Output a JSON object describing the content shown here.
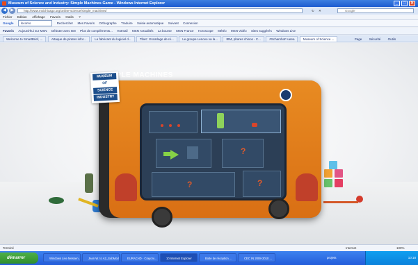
{
  "window": {
    "title": "Museum of Science and Industry: Simple Machines Game - Windows Internet Explorer",
    "minimize": "_",
    "maximize": "□",
    "close": "✕"
  },
  "addressbar": {
    "back": "◀",
    "forward": "▶",
    "url": "http://www.msichicago.org/online-science/simple_machines/",
    "search_placeholder": "Google",
    "refresh": "↻",
    "stop": "✕"
  },
  "menubar": {
    "items": [
      "Fichier",
      "Edition",
      "Affichage",
      "Favoris",
      "Outils",
      "?"
    ]
  },
  "google_toolbar": {
    "label": "Google",
    "search_value": "locomo",
    "items": [
      "Rechercher",
      "Mes Favoris",
      "Orthographe",
      "Traduire",
      "Saisie automatique",
      "Suivant",
      "Connexion"
    ]
  },
  "favorites_bar": {
    "label": "Favoris",
    "items": [
      "Aujourd'hui sur MSN",
      "Débuter avec IE8",
      "Plus de compléments...",
      "Hotmail",
      "MSN Actualités",
      "La bourse",
      "MSN France",
      "Horoscope",
      "Météo",
      "MSN Vidéo",
      "Sites suggérés",
      "Windows Live"
    ]
  },
  "tabs": [
    {
      "label": "Welcome to SmartBrief, ...",
      "active": false
    },
    {
      "label": "Attaque de pirates infor...",
      "active": false
    },
    {
      "label": "Le fabricant du logiciel d...",
      "active": false
    },
    {
      "label": "Tibet : Escarlage de ré...",
      "active": false
    },
    {
      "label": "Le groupe Lenovo va la...",
      "active": false
    },
    {
      "label": "IBM, phares chinos - C...",
      "active": false
    },
    {
      "label": "#ScharnhoF+area",
      "active": false
    },
    {
      "label": "Museum of Science ...",
      "active": true
    }
  ],
  "tab_tools": [
    "Page",
    "Sécurité",
    "Outils"
  ],
  "game": {
    "logo": [
      "MUSEUM",
      "OF",
      "SCIENCE",
      "INDUSTRY"
    ],
    "header": "SIMPLE MACHINES"
  },
  "statusbar": {
    "left": "Terminé",
    "zone": "Internet",
    "zoom": "100%"
  },
  "taskbar": {
    "start": "démarrer",
    "items": [
      {
        "label": "Windows Live Messen...",
        "active": false
      },
      {
        "label": "Jean W. to A2_SubMod...",
        "active": false
      },
      {
        "label": "EURACHD - Crayoni...",
        "active": false
      },
      {
        "label": "10 Internet Explorer",
        "active": true
      },
      {
        "label": "Boite de réception ...",
        "active": false
      },
      {
        "label": "CEC IN 2008-2010 ...",
        "active": false
      }
    ],
    "tray_label": "projets",
    "clock": "10:18"
  },
  "colors": {
    "titlebar": "#1b5bd0",
    "device_orange": "#e07a1a",
    "screen": "#2c3f56",
    "taskbar": "#245ddb",
    "start": "#3a9c36"
  }
}
